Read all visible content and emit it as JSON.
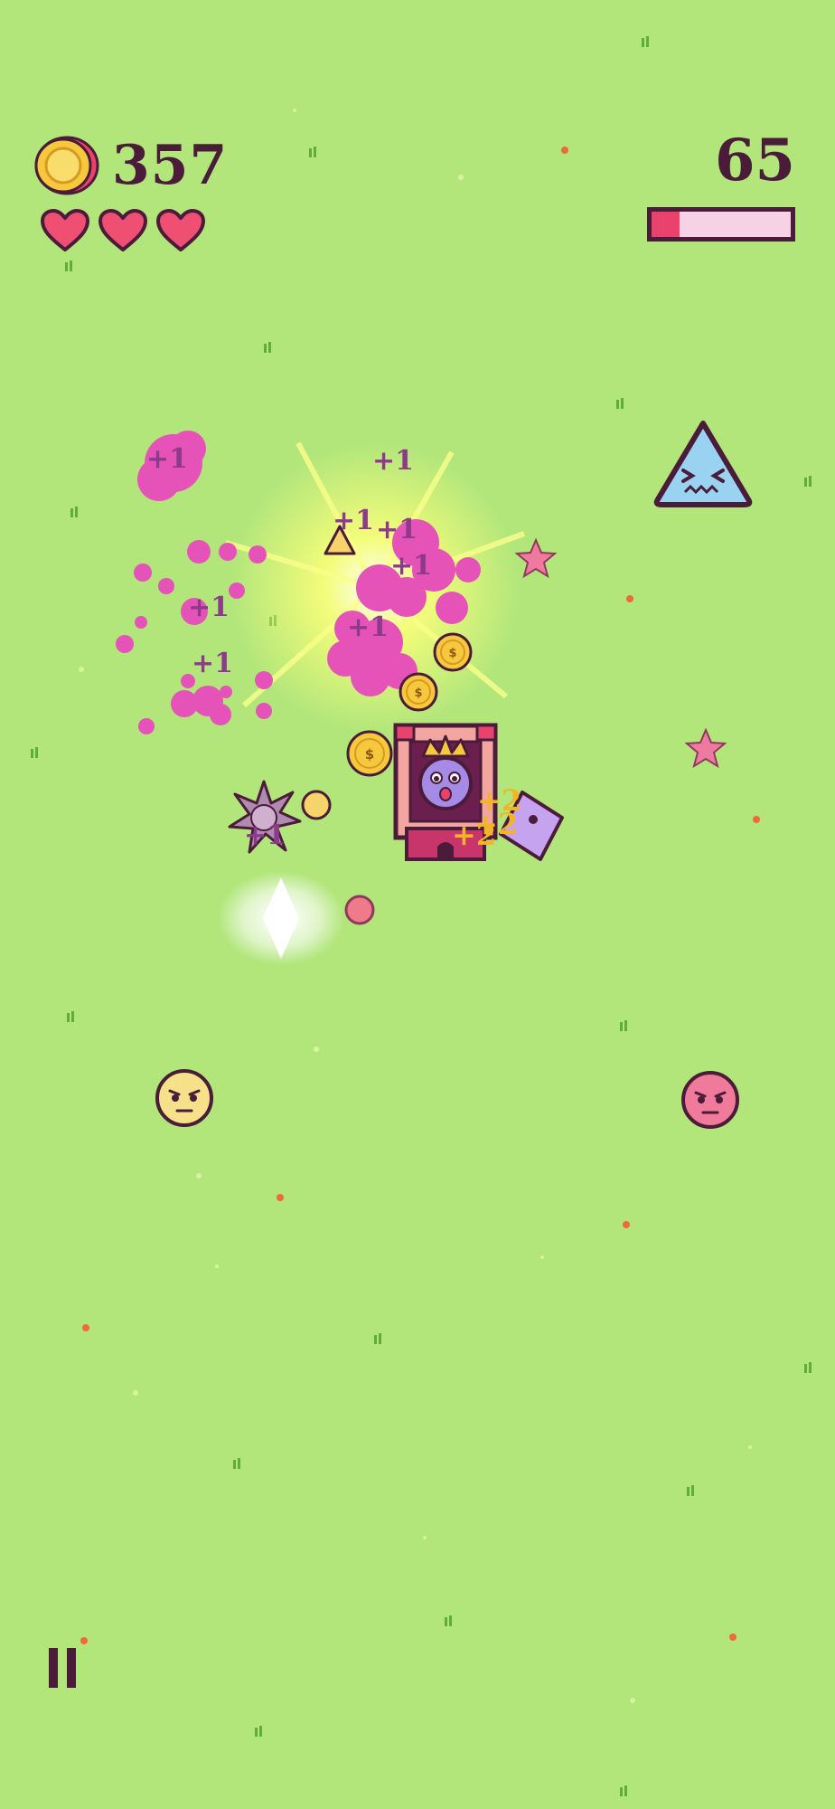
{
  "hud": {
    "coin_count": "357",
    "coin_icon": "gold-coin-icon",
    "lives": 3,
    "score": "65",
    "progress_fraction": 0.2,
    "colors": {
      "background": "#b2e67b",
      "text": "#4a1c3a",
      "heart": "#ef4f73",
      "progress_fill": "#e9426d",
      "progress_empty": "#f6d2e4"
    }
  },
  "floating_text": {
    "plus_one": "+1",
    "plus_two": "+2"
  },
  "controls": {
    "pause_icon": "pause-icon"
  },
  "entities": {
    "castle": "castle-tower",
    "player": "king-player",
    "enemies": [
      "triangle-enemy",
      "yellow-round-enemy",
      "pink-round-enemy",
      "purple-gem-enemy",
      "spiked-mine-enemy"
    ],
    "pickups": [
      "gold-coin",
      "pink-star"
    ]
  }
}
